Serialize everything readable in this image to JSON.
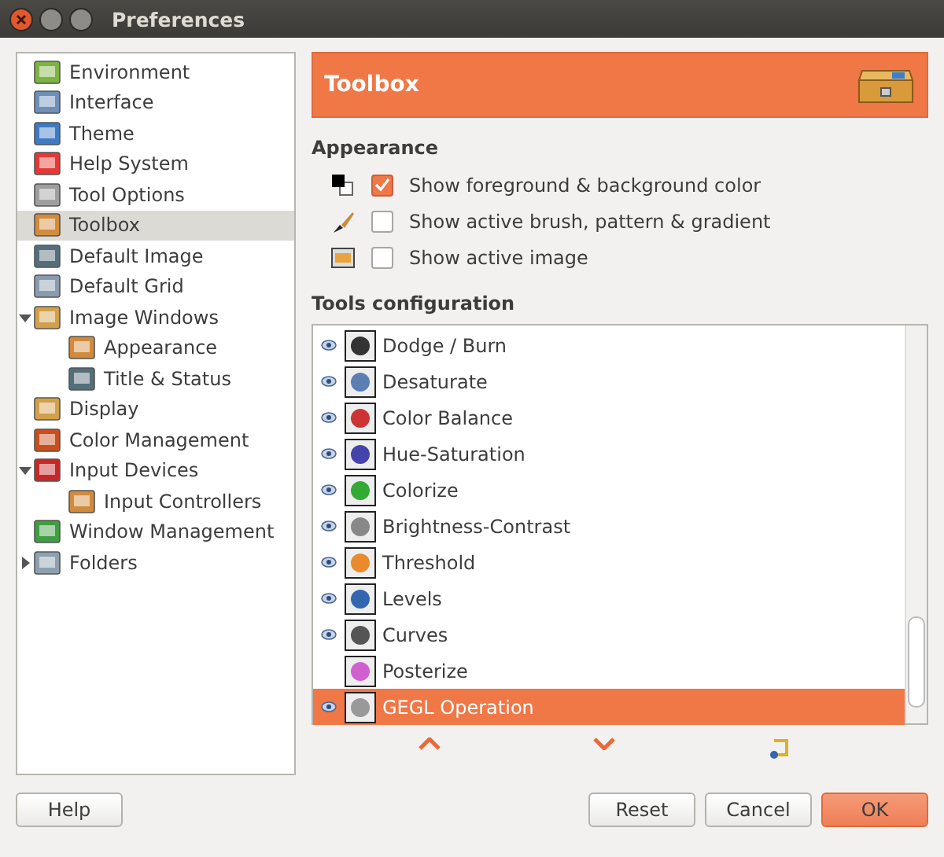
{
  "window": {
    "title": "Preferences"
  },
  "sidebar": {
    "items": [
      {
        "label": "Environment",
        "selected": false
      },
      {
        "label": "Interface",
        "selected": false
      },
      {
        "label": "Theme",
        "selected": false
      },
      {
        "label": "Help System",
        "selected": false
      },
      {
        "label": "Tool Options",
        "selected": false
      },
      {
        "label": "Toolbox",
        "selected": true
      },
      {
        "label": "Default Image",
        "selected": false
      },
      {
        "label": "Default Grid",
        "selected": false
      },
      {
        "label": "Image Windows",
        "selected": false,
        "expanded": true,
        "children": [
          {
            "label": "Appearance",
            "selected": false
          },
          {
            "label": "Title & Status",
            "selected": false
          }
        ]
      },
      {
        "label": "Display",
        "selected": false
      },
      {
        "label": "Color Management",
        "selected": false
      },
      {
        "label": "Input Devices",
        "selected": false,
        "expanded": true,
        "children": [
          {
            "label": "Input Controllers",
            "selected": false
          }
        ]
      },
      {
        "label": "Window Management",
        "selected": false
      },
      {
        "label": "Folders",
        "selected": false,
        "expanded": false
      }
    ]
  },
  "header": {
    "title": "Toolbox"
  },
  "appearance": {
    "heading": "Appearance",
    "options": [
      {
        "label": "Show foreground & background color",
        "checked": true
      },
      {
        "label": "Show active brush, pattern & gradient",
        "checked": false
      },
      {
        "label": "Show active image",
        "checked": false
      }
    ]
  },
  "tools": {
    "heading": "Tools configuration",
    "rows": [
      {
        "label": "Dodge / Burn",
        "visible": true,
        "selected": false
      },
      {
        "label": "Desaturate",
        "visible": true,
        "selected": false
      },
      {
        "label": "Color Balance",
        "visible": true,
        "selected": false
      },
      {
        "label": "Hue-Saturation",
        "visible": true,
        "selected": false
      },
      {
        "label": "Colorize",
        "visible": true,
        "selected": false
      },
      {
        "label": "Brightness-Contrast",
        "visible": true,
        "selected": false
      },
      {
        "label": "Threshold",
        "visible": true,
        "selected": false
      },
      {
        "label": "Levels",
        "visible": true,
        "selected": false
      },
      {
        "label": "Curves",
        "visible": true,
        "selected": false
      },
      {
        "label": "Posterize",
        "visible": false,
        "selected": false
      },
      {
        "label": "GEGL Operation",
        "visible": true,
        "selected": true
      }
    ]
  },
  "buttons": {
    "help": "Help",
    "reset": "Reset",
    "cancel": "Cancel",
    "ok": "OK"
  }
}
